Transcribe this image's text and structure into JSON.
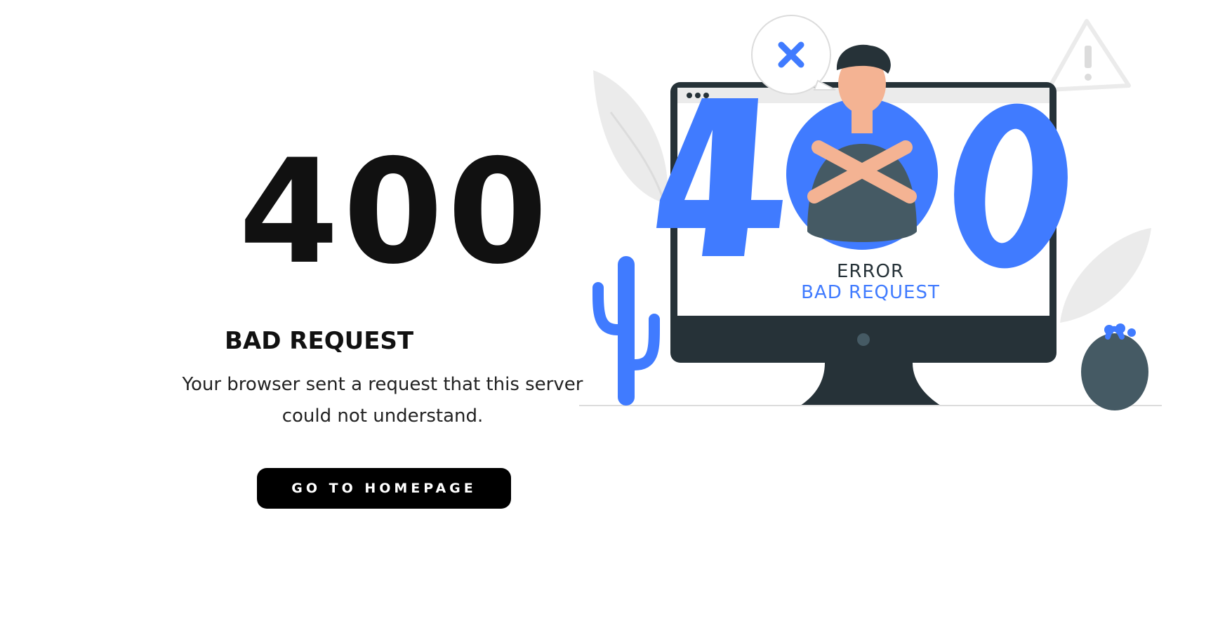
{
  "error": {
    "code": "400",
    "title": "BAD REQUEST",
    "message": "Your browser sent a request that this server could not understand."
  },
  "actions": {
    "home_label": "GO TO HOMEPAGE"
  },
  "illustration": {
    "big_code": "400",
    "screen_line_1": "ERROR",
    "screen_line_2": "BAD REQUEST"
  },
  "colors": {
    "accent": "#407BFF",
    "dark": "#263238",
    "text": "#111111",
    "button_bg": "#000000",
    "button_text": "#ffffff",
    "light_gray": "#EBEBEB"
  },
  "icons": [
    "close-icon",
    "warning-icon",
    "cactus-icon",
    "plant-icon",
    "leaf-icon"
  ]
}
